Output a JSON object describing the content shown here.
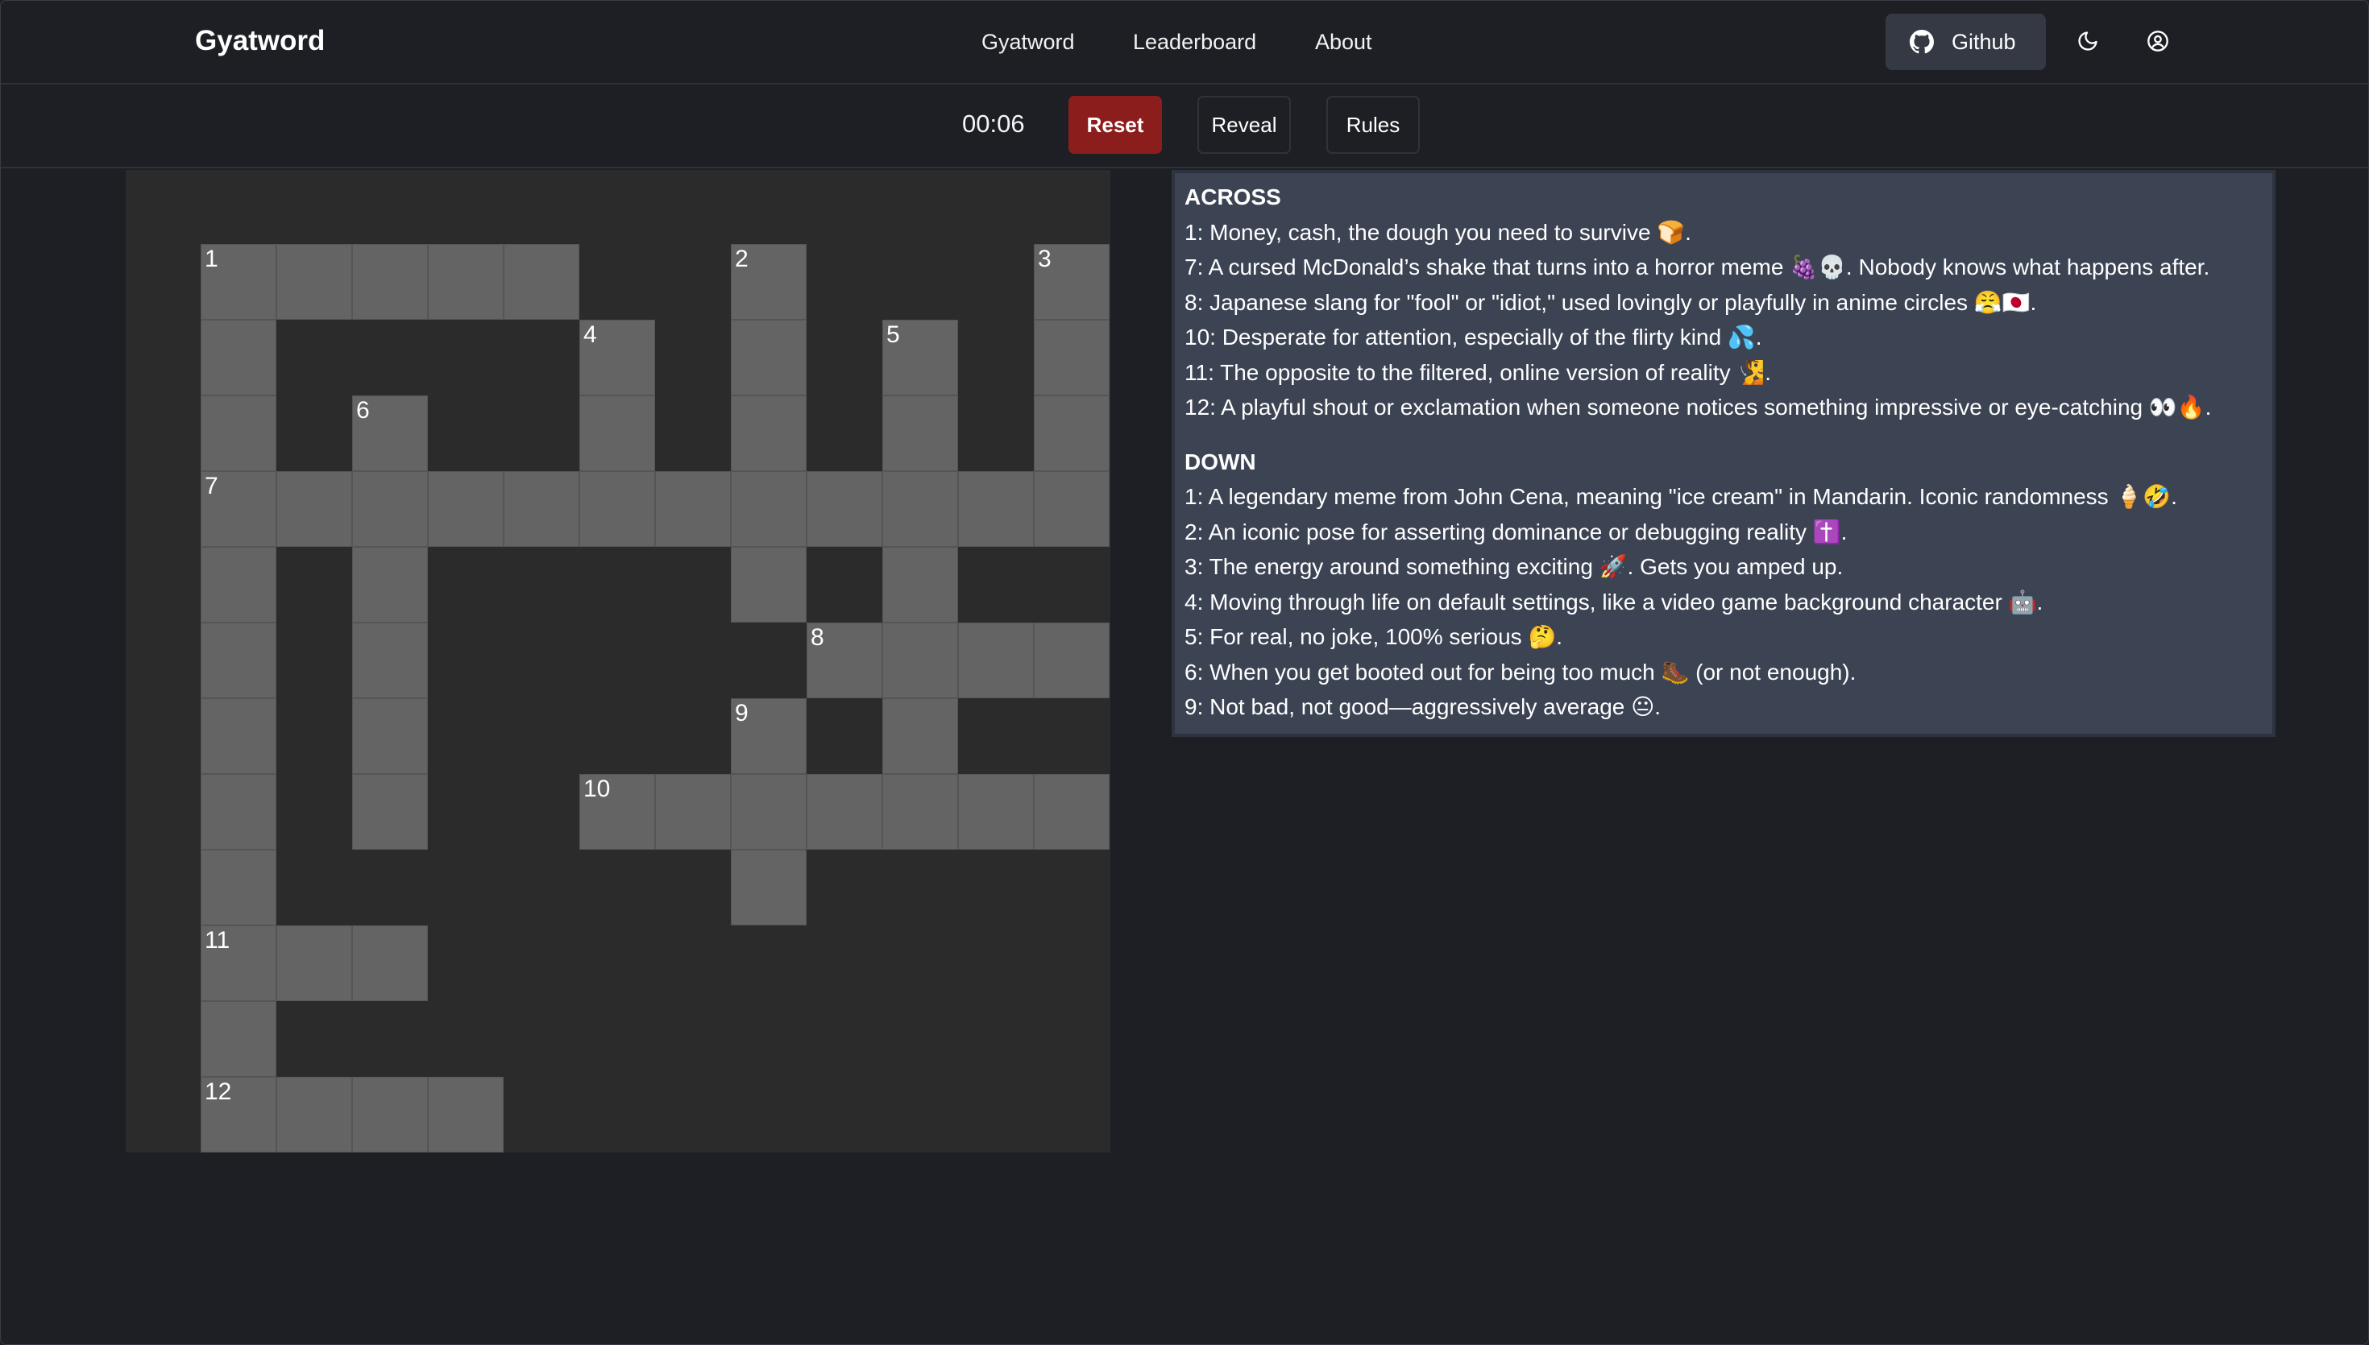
{
  "navbar": {
    "brand": "Gyatword",
    "links": [
      "Gyatword",
      "Leaderboard",
      "About"
    ],
    "github_label": "Github"
  },
  "toolbar": {
    "timer": "00:06",
    "reset_label": "Reset",
    "reveal_label": "Reveal",
    "rules_label": "Rules"
  },
  "grid": {
    "rows": 12,
    "cols": 12,
    "cells": [
      [
        0,
        0,
        "1"
      ],
      [
        0,
        1
      ],
      [
        0,
        2
      ],
      [
        0,
        3
      ],
      [
        0,
        4
      ],
      [
        0,
        7,
        "2"
      ],
      [
        0,
        11,
        "3"
      ],
      [
        1,
        0
      ],
      [
        1,
        5,
        "4"
      ],
      [
        1,
        7
      ],
      [
        1,
        9,
        "5"
      ],
      [
        1,
        11
      ],
      [
        2,
        0
      ],
      [
        2,
        2,
        "6"
      ],
      [
        2,
        5
      ],
      [
        2,
        7
      ],
      [
        2,
        9
      ],
      [
        2,
        11
      ],
      [
        3,
        0,
        "7"
      ],
      [
        3,
        1
      ],
      [
        3,
        2
      ],
      [
        3,
        3
      ],
      [
        3,
        4
      ],
      [
        3,
        5
      ],
      [
        3,
        6
      ],
      [
        3,
        7
      ],
      [
        3,
        8
      ],
      [
        3,
        9
      ],
      [
        3,
        10
      ],
      [
        3,
        11
      ],
      [
        4,
        0
      ],
      [
        4,
        2
      ],
      [
        4,
        7
      ],
      [
        4,
        9
      ],
      [
        5,
        0
      ],
      [
        5,
        2
      ],
      [
        5,
        8,
        "8"
      ],
      [
        5,
        9
      ],
      [
        5,
        10
      ],
      [
        5,
        11
      ],
      [
        6,
        0
      ],
      [
        6,
        2
      ],
      [
        6,
        7,
        "9"
      ],
      [
        6,
        9
      ],
      [
        7,
        0
      ],
      [
        7,
        2
      ],
      [
        7,
        5,
        "10"
      ],
      [
        7,
        6
      ],
      [
        7,
        7
      ],
      [
        7,
        8
      ],
      [
        7,
        9
      ],
      [
        7,
        10
      ],
      [
        7,
        11
      ],
      [
        8,
        0
      ],
      [
        8,
        7
      ],
      [
        9,
        0,
        "11"
      ],
      [
        9,
        1
      ],
      [
        9,
        2
      ],
      [
        10,
        0
      ],
      [
        11,
        0,
        "12"
      ],
      [
        11,
        1
      ],
      [
        11,
        2
      ],
      [
        11,
        3
      ]
    ]
  },
  "clues": {
    "across_heading": "ACROSS",
    "across": [
      "1: Money, cash, the dough you need to survive 🍞.",
      "7: A cursed McDonald’s shake that turns into a horror meme 🍇💀. Nobody knows what happens after.",
      "8: Japanese slang for \"fool\" or \"idiot,\" used lovingly or playfully in anime circles 😤🇯🇵.",
      "10: Desperate for attention, especially of the flirty kind 💦.",
      "11: The opposite to the filtered, online version of reality 🧏.",
      "12: A playful shout or exclamation when someone notices something impressive or eye-catching 👀🔥."
    ],
    "down_heading": "DOWN",
    "down": [
      "1: A legendary meme from John Cena, meaning \"ice cream\" in Mandarin. Iconic randomness 🍦🤣.",
      "2: An iconic pose for asserting dominance or debugging reality ✝️.",
      "3: The energy around something exciting 🚀. Gets you amped up.",
      "4: Moving through life on default settings, like a video game background character 🤖.",
      "5: For real, no joke, 100% serious 🤔.",
      "6: When you get booted out for being too much 🥾 (or not enough).",
      "9: Not bad, not good—aggressively average 😐."
    ]
  }
}
